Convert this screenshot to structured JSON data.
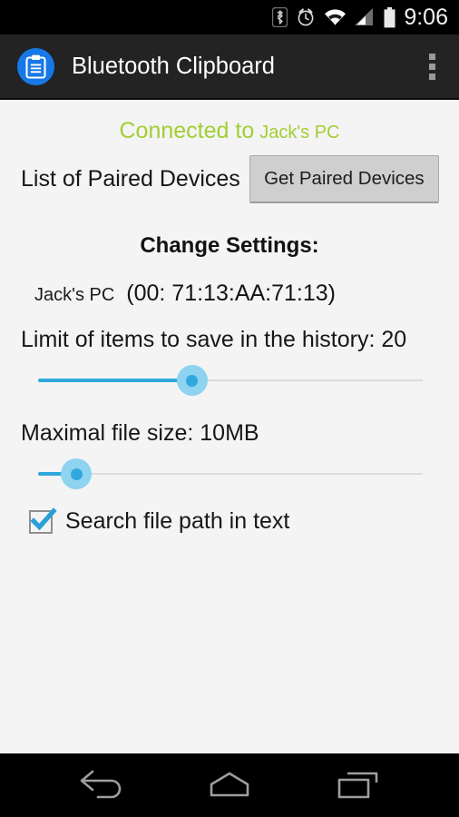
{
  "statusbar": {
    "time": "9:06",
    "icons": [
      "bluetooth-icon",
      "alarm-icon",
      "wifi-icon",
      "signal-icon",
      "battery-icon"
    ]
  },
  "actionbar": {
    "app_icon": "clipboard-icon",
    "title": "Bluetooth Clipboard",
    "overflow_icon": "overflow-menu-icon",
    "bg_color": "#232323"
  },
  "connection": {
    "status_prefix": "Connected to",
    "device": "Jack's PC",
    "color": "#a2ce33"
  },
  "paired": {
    "label": "List of Paired Devices",
    "button_label": "Get Paired Devices"
  },
  "settings": {
    "heading": "Change Settings:",
    "device_name": "Jack's PC",
    "device_mac": "(00: 71:13:AA:71:13)",
    "history": {
      "label": "Limit of items to save in the history: 20",
      "value": 20,
      "thumb_percent": 40
    },
    "filesize": {
      "label": "Maximal file size: 10MB",
      "value": "10MB",
      "thumb_percent": 10
    },
    "checkbox": {
      "label": "Search file path in text",
      "checked": true,
      "accent": "#2a9fd6"
    },
    "slider_accent": "#2fa8dd",
    "slider_halo": "#8ed3ef"
  },
  "navbar": {
    "back": "back-icon",
    "home": "home-icon",
    "recents": "recents-icon"
  }
}
